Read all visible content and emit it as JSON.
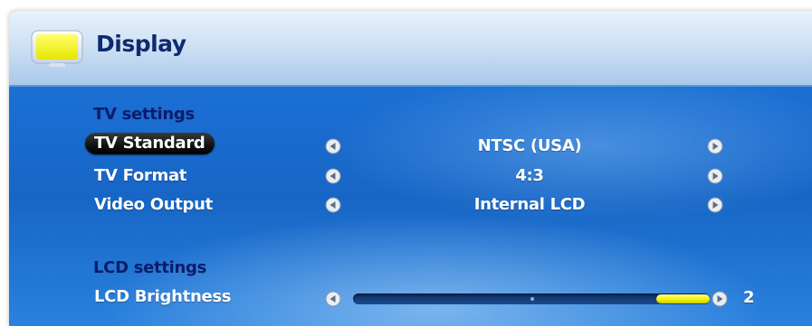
{
  "header": {
    "title": "Display",
    "icon": "tv-screen-icon"
  },
  "tv_settings": {
    "section_title": "TV settings",
    "rows": [
      {
        "label": "TV Standard",
        "value": "NTSC (USA)",
        "selected": true
      },
      {
        "label": "TV Format",
        "value": "4:3",
        "selected": false
      },
      {
        "label": "Video Output",
        "value": "Internal LCD",
        "selected": false
      }
    ]
  },
  "lcd_settings": {
    "section_title": "LCD settings",
    "brightness": {
      "label": "LCD Brightness",
      "value": "2",
      "level_fraction": 0.15
    }
  },
  "colors": {
    "accent_yellow": "#f4f400",
    "section_title": "#0b1c6a",
    "background_blue": "#1a6cd0"
  }
}
